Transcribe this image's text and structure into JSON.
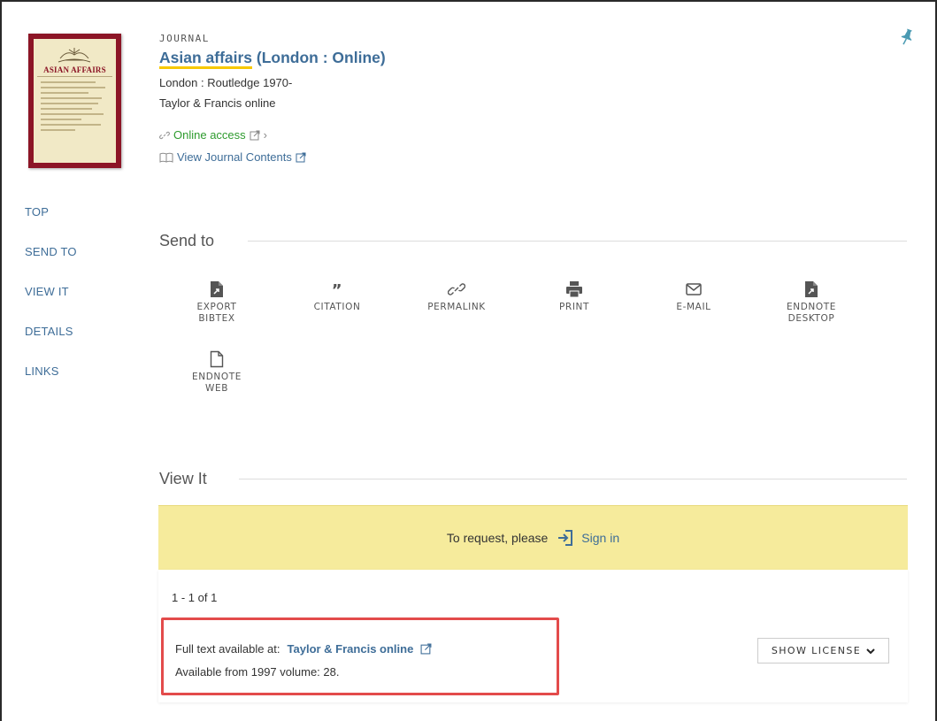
{
  "record": {
    "type_label": "JOURNAL",
    "title_highlight": "Asian affairs",
    "title_rest": " (London : Online)",
    "publisher": "London : Routledge 1970-",
    "source": "Taylor & Francis online",
    "online_access": "Online access",
    "journal_contents": "View Journal Contents",
    "cover_title": "ASIAN AFFAIRS"
  },
  "sidenav": {
    "items": [
      {
        "label": "TOP"
      },
      {
        "label": "SEND TO"
      },
      {
        "label": "VIEW IT"
      },
      {
        "label": "DETAILS"
      },
      {
        "label": "LINKS"
      }
    ]
  },
  "send_to": {
    "title": "Send to",
    "actions": [
      {
        "line1": "EXPORT",
        "line2": "BIBTEX",
        "icon": "file-export-icon"
      },
      {
        "line1": "CITATION",
        "line2": "",
        "icon": "quote-icon"
      },
      {
        "line1": "PERMALINK",
        "line2": "",
        "icon": "link-icon"
      },
      {
        "line1": "PRINT",
        "line2": "",
        "icon": "printer-icon"
      },
      {
        "line1": "E-MAIL",
        "line2": "",
        "icon": "envelope-icon"
      },
      {
        "line1": "ENDNOTE",
        "line2": "DESKTOP",
        "icon": "file-export-icon"
      },
      {
        "line1": "ENDNOTE",
        "line2": "WEB",
        "icon": "file-outline-icon"
      }
    ]
  },
  "view_it": {
    "title": "View It",
    "request_text": "To request, please",
    "sign_in": "Sign in",
    "count": "1 - 1 of 1",
    "fulltext_label": "Full text available at:",
    "fulltext_link": "Taylor & Francis online",
    "availability": "Available from 1997 volume: 28.",
    "license_button": "SHOW LICENSE"
  },
  "colors": {
    "link": "#3e6d98",
    "online": "#2e9b2e",
    "banner": "#f6eb9c",
    "highlight_border": "#e34b4b",
    "title_underline": "#f7c800"
  }
}
